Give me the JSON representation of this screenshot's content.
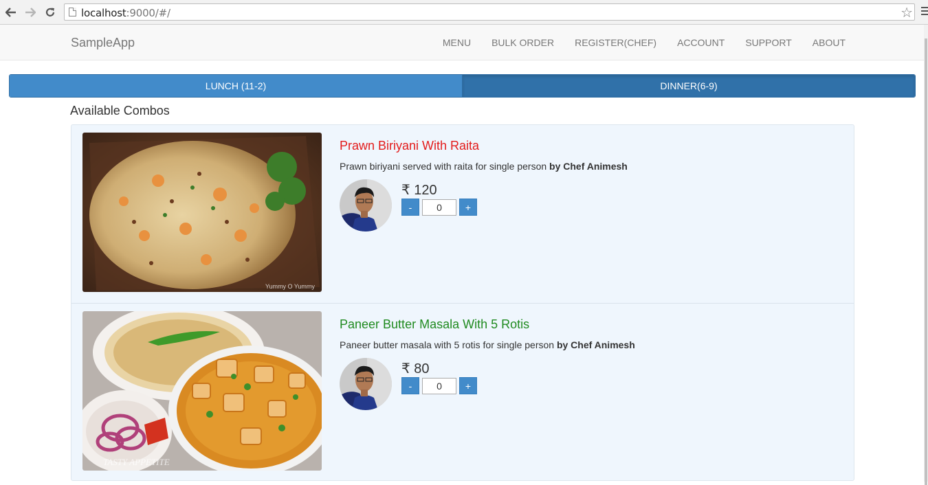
{
  "browser": {
    "url_host": "localhost",
    "url_rest": ":9000/#/"
  },
  "navbar": {
    "brand": "SampleApp",
    "links": [
      "MENU",
      "BULK ORDER",
      "REGISTER(CHEF)",
      "ACCOUNT",
      "SUPPORT",
      "ABOUT"
    ]
  },
  "tabs": [
    {
      "label": "LUNCH (11-2)",
      "active": false
    },
    {
      "label": "DINNER(6-9)",
      "active": true
    }
  ],
  "section_title": "Available Combos",
  "combos": [
    {
      "title": "Prawn Biriyani With Raita",
      "title_color": "#e31b1b",
      "description": "Prawn biriyani served with raita for single person",
      "chef": "by Chef Animesh",
      "price": "₹ 120",
      "quantity": "0",
      "minus_label": "-",
      "plus_label": "+",
      "watermark": "Yummy O Yummy"
    },
    {
      "title": "Paneer Butter Masala With 5 Rotis",
      "title_color": "#1f8a1f",
      "description": "Paneer butter masala with 5 rotis for single person",
      "chef": "by Chef Animesh",
      "price": "₹ 80",
      "quantity": "0",
      "minus_label": "-",
      "plus_label": "+",
      "watermark": "TASTY APPETITE"
    }
  ],
  "colors": {
    "primary": "#428bca",
    "primary_dark": "#3071a9",
    "panel_bg": "#eff6fd"
  },
  "icons": [
    "back-arrow-icon",
    "forward-arrow-icon",
    "reload-icon",
    "page-icon",
    "star-icon",
    "browser-menu-icon"
  ]
}
